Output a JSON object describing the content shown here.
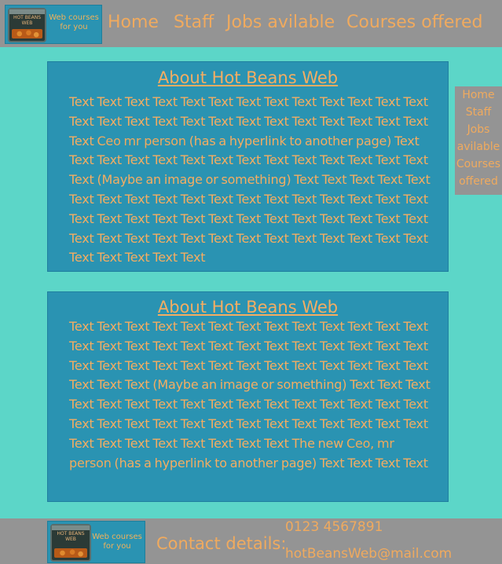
{
  "header": {
    "logo": {
      "tagline_line1": "Web courses",
      "tagline_line2": "for you",
      "can_mark": "HOT BEANS WEB"
    },
    "nav": {
      "home": "Home",
      "staff": "Staff",
      "jobs": "Jobs avilable",
      "courses": "Courses offered"
    }
  },
  "sidenav": {
    "home": "Home",
    "staff": "Staff",
    "jobs_line1": "Jobs",
    "jobs_line2": "avilable",
    "courses_line1": "Courses",
    "courses_line2": "offered"
  },
  "section1": {
    "title": "About Hot Beans Web",
    "text_before_link": "Text Text Text Text Text Text Text Text Text Text Text Text Text Text Text Text Text Text Text Text Text Text Text Text Text Text Text",
    "link": "Ceo mr person",
    "text_after_link": "(has a hyperlink to another page) Text Text Text Text Text Text Text Text Text Text Text Text Text Text Text (Maybe an image or something) Text Text Text Text Text Text Text Text Text Text Text Text Text Text Text Text Text Text Text Text Text Text Text Text Text Text Text Text Text Text Text Text Text Text Text Text Text Text Text Text Text Text Text Text Text Text Text Text Text"
  },
  "section2": {
    "title": "About Hot Beans Web",
    "text_before_link": "Text Text Text Text Text Text Text Text Text Text Text Text Text Text Text Text Text Text Text Text Text Text Text Text Text Text Text  Text Text Text Text Text Text Text Text Text Text Text Text Text Text Text (Maybe an image or something) Text Text Text Text Text Text Text Text Text Text Text Text Text Text Text Text Text Text Text Text Text Text Text Text Text Text Text Text Text Text Text Text Text Text Text Text Text The new",
    "link": "Ceo, mr person",
    "text_after_link": "(has a hyperlink to another page) Text Text Text Text"
  },
  "footer": {
    "logo": {
      "tagline_line1": "Web courses",
      "tagline_line2": "for you",
      "can_mark": "HOT BEANS WEB"
    },
    "contact_label": "Contact details:",
    "phone": "0123 4567891",
    "email": "hotBeansWeb@mail.com"
  },
  "colors": {
    "background": "#5cd6c8",
    "bar": "#949494",
    "panel": "#2a93b2",
    "text": "#f4ad62"
  }
}
